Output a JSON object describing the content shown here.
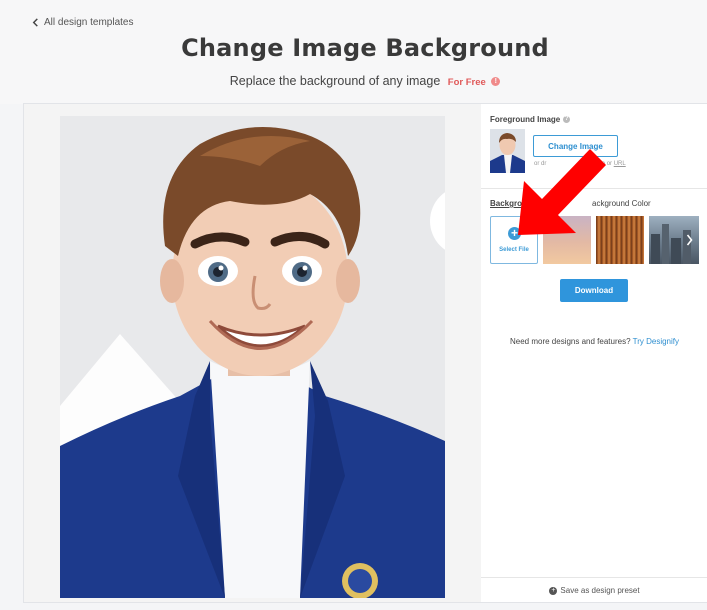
{
  "header": {
    "back_label": "All design templates",
    "title": "Change Image Background",
    "subtitle": "Replace the background of any image",
    "free_label": "For Free"
  },
  "panel": {
    "foreground_label": "Foreground Image",
    "change_image_label": "Change Image",
    "drop_hint_prefix": "or dr",
    "drop_hint_suffix": "an image or",
    "drop_hint_url": "URL",
    "background_tab_visible": "Backgro",
    "background_color_visible": "ackground Color",
    "select_file_label": "Select File",
    "download_label": "Download",
    "more_text": "Need more designs and features?",
    "more_link": "Try Designify",
    "save_preset_label": "Save as design preset"
  },
  "colors": {
    "accent": "#2f95dc",
    "free": "#e05a5a",
    "arrow": "#ff0000",
    "jacket": "#1d3a8c"
  },
  "icons": [
    "chevron-left-icon",
    "info-icon",
    "question-icon",
    "plus-icon",
    "chevron-right-icon",
    "save-icon",
    "red-arrow-annotation"
  ]
}
